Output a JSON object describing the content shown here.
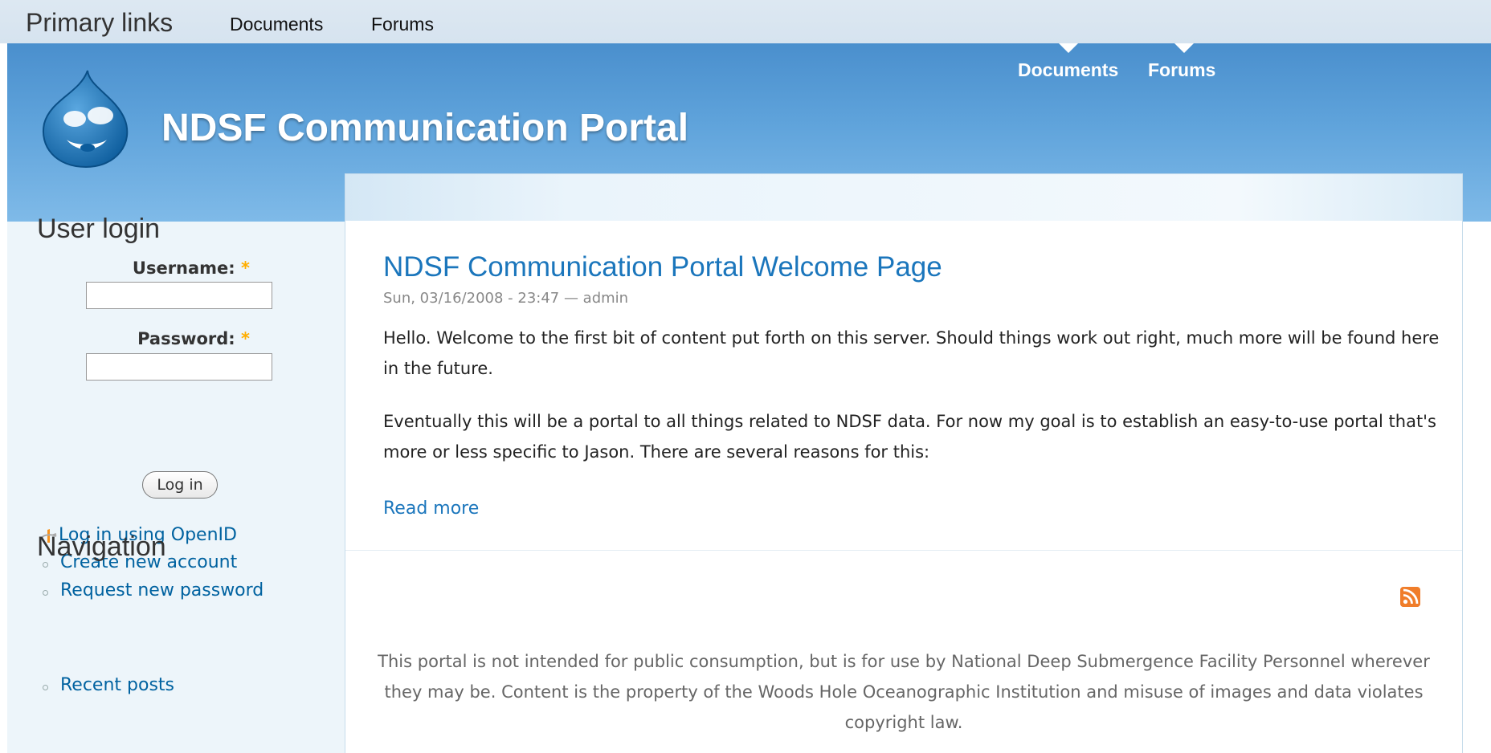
{
  "primary_bar": {
    "title": "Primary links",
    "links": [
      "Documents",
      "Forums"
    ]
  },
  "header": {
    "site_name": "NDSF Communication Portal",
    "links": [
      "Documents",
      "Forums"
    ]
  },
  "sidebar": {
    "login": {
      "heading": "User login",
      "username_label": "Username:",
      "password_label": "Password:",
      "required_mark": "*",
      "username_value": "",
      "password_value": "",
      "button_label": "Log in",
      "links": [
        "Log in using OpenID",
        "Create new account",
        "Request new password"
      ]
    },
    "navigation": {
      "heading": "Navigation",
      "links": [
        "Recent posts"
      ]
    }
  },
  "node": {
    "title": "NDSF Communication Portal Welcome Page",
    "meta": "Sun, 03/16/2008 - 23:47 — admin",
    "paragraphs": [
      "Hello. Welcome to the first bit of content put forth on this server. Should things work out right, much more will be found here in the future.",
      "Eventually this will be a portal to all things related to NDSF data. For now my goal is to establish an easy-to-use portal that's more or less specific to Jason. There are several reasons for this:"
    ],
    "read_more": "Read more"
  },
  "footer": {
    "message": "This portal is not intended for public consumption, but is for use by National Deep Submergence Facility Personnel wherever they may be. Content is the property of the Woods Hole Oceanographic Institution and misuse of images and data violates copyright law."
  },
  "colors": {
    "header_blue": "#4a8fcd",
    "link_blue": "#1b76bc",
    "required_orange": "#ffae00",
    "rss_orange": "#f07d2a"
  },
  "icons": [
    "drupal-logo-icon",
    "openid-icon",
    "rss-feed-icon"
  ]
}
